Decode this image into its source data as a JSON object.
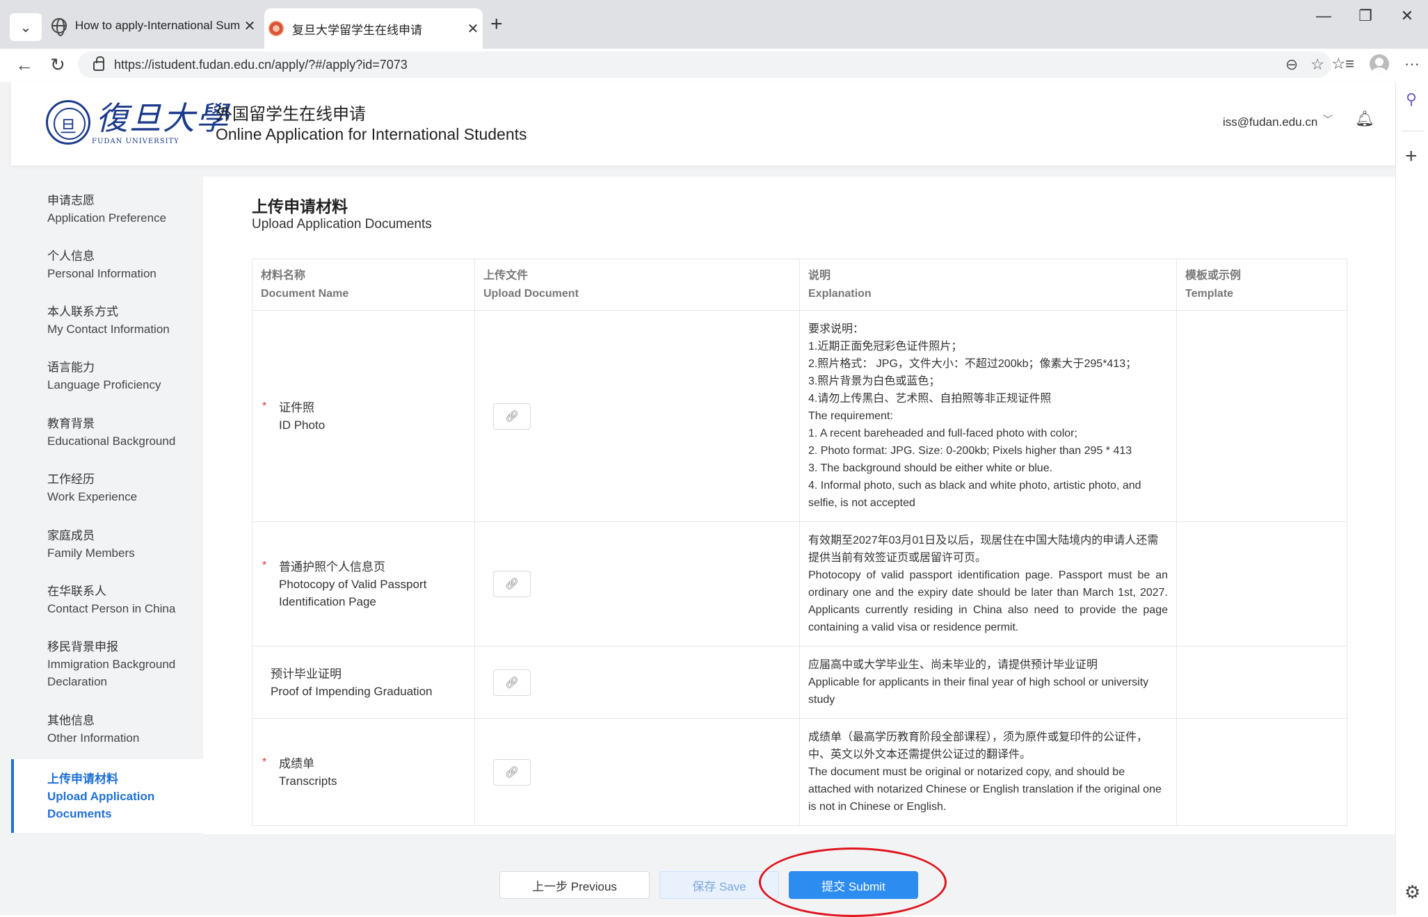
{
  "browser": {
    "tabs": [
      {
        "title": "How to apply-International Summ",
        "active": false
      },
      {
        "title": "复旦大学留学生在线申请",
        "active": true
      }
    ],
    "url": "https://istudent.fudan.edu.cn/apply/?#/apply?id=7073"
  },
  "header": {
    "logo_text": "復旦大學",
    "logo_sub": "FUDAN UNIVERSITY",
    "title_cn": "外国留学生在线申请",
    "title_en": "Online Application for International Students",
    "user_email": "iss@fudan.edu.cn"
  },
  "sidebar": {
    "items": [
      {
        "cn": "申请志愿",
        "en": "Application Preference"
      },
      {
        "cn": "个人信息",
        "en": "Personal Information"
      },
      {
        "cn": "本人联系方式",
        "en": "My Contact Information"
      },
      {
        "cn": "语言能力",
        "en": "Language Proficiency"
      },
      {
        "cn": "教育背景",
        "en": "Educational Background"
      },
      {
        "cn": "工作经历",
        "en": "Work Experience"
      },
      {
        "cn": "家庭成员",
        "en": "Family Members"
      },
      {
        "cn": "在华联系人",
        "en": "Contact Person in China"
      },
      {
        "cn": "移民背景申报",
        "en": "Immigration Background Declaration"
      },
      {
        "cn": "其他信息",
        "en": "Other Information"
      },
      {
        "cn": "上传申请材料",
        "en": "Upload Application Documents",
        "active": true
      }
    ]
  },
  "section": {
    "title_cn": "上传申请材料",
    "title_en": "Upload Application Documents"
  },
  "table": {
    "headers": [
      {
        "cn": "材料名称",
        "en": "Document Name"
      },
      {
        "cn": "上传文件",
        "en": "Upload Document"
      },
      {
        "cn": "说明",
        "en": "Explanation"
      },
      {
        "cn": "模板或示例",
        "en": "Template"
      }
    ],
    "rows": [
      {
        "required": true,
        "name_lines": [
          "证件照",
          "ID Photo"
        ],
        "explanation": [
          "要求说明：",
          "1.近期正面免冠彩色证件照片；",
          "2.照片格式： JPG，文件大小：不超过200kb；像素大于295*413；",
          "3.照片背景为白色或蓝色；",
          "4.请勿上传黑白、艺术照、自拍照等非正规证件照",
          "The requirement:",
          "1. A recent bareheaded and full-faced photo with color;",
          "2. Photo format: JPG. Size: 0-200kb; Pixels higher than 295 * 413",
          "3. The background should be either white or blue.",
          "4. Informal photo, such as black and white photo, artistic photo, and selfie, is not accepted"
        ]
      },
      {
        "required": true,
        "name_lines": [
          "普通护照个人信息页",
          "Photocopy of Valid Passport",
          "Identification Page"
        ],
        "explanation": [
          "有效期至2027年03月01日及以后，现居住在中国大陆境内的申请人还需提供当前有效签证页或居留许可页。",
          "Photocopy of valid passport identification page. Passport must be an ordinary one and the expiry date should be later than March 1st, 2027. Applicants currently residing in China also need to provide the page containing a valid visa or residence permit."
        ]
      },
      {
        "required": false,
        "name_lines": [
          "预计毕业证明",
          "Proof of Impending Graduation"
        ],
        "explanation": [
          "应届高中或大学毕业生、尚未毕业的，请提供预计毕业证明",
          "Applicable for applicants in their final year of high school or university study"
        ]
      },
      {
        "required": true,
        "name_lines": [
          "成绩单",
          "Transcripts"
        ],
        "explanation": [
          "成绩单（最高学历教育阶段全部课程），须为原件或复印件的公证件，中、英文以外文本还需提供公证过的翻译件。",
          "The document must be original or notarized copy, and should be attached with notarized Chinese or English translation if the original one is not in Chinese or English."
        ]
      }
    ]
  },
  "buttons": {
    "previous": "上一步 Previous",
    "save": "保存 Save",
    "submit": "提交 Submit"
  },
  "colors": {
    "accent": "#1f6fd6",
    "submit": "#2d8cf0",
    "highlight_ellipse": "#e0131b",
    "required_star": "#e0333a"
  }
}
